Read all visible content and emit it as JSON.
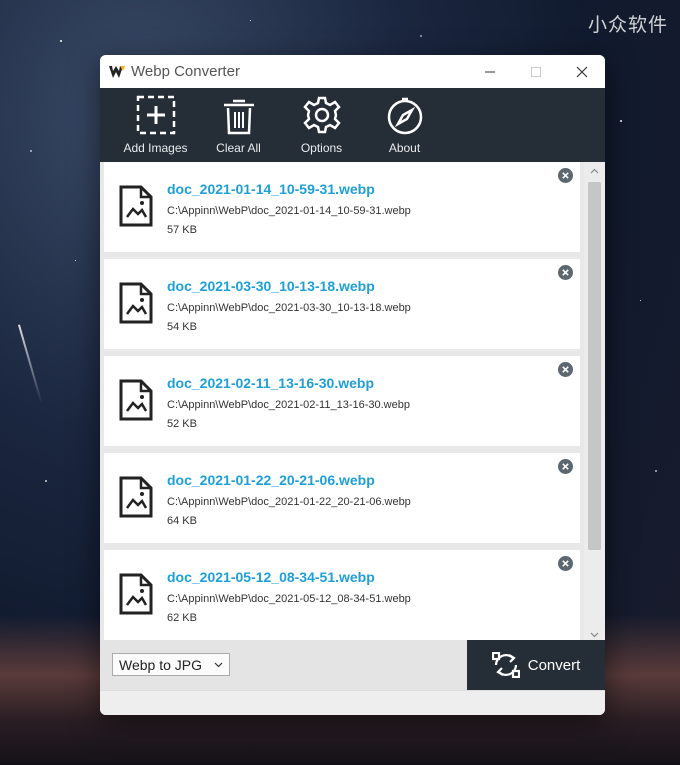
{
  "watermark": "小众软件",
  "window": {
    "title": "Webp Converter"
  },
  "toolbar": {
    "add_images": "Add Images",
    "clear_all": "Clear All",
    "options": "Options",
    "about": "About"
  },
  "files": [
    {
      "name": "doc_2021-01-14_10-59-31.webp",
      "path": "C:\\Appinn\\WebP\\doc_2021-01-14_10-59-31.webp",
      "size": "57 KB"
    },
    {
      "name": "doc_2021-03-30_10-13-18.webp",
      "path": "C:\\Appinn\\WebP\\doc_2021-03-30_10-13-18.webp",
      "size": "54 KB"
    },
    {
      "name": "doc_2021-02-11_13-16-30.webp",
      "path": "C:\\Appinn\\WebP\\doc_2021-02-11_13-16-30.webp",
      "size": "52 KB"
    },
    {
      "name": "doc_2021-01-22_20-21-06.webp",
      "path": "C:\\Appinn\\WebP\\doc_2021-01-22_20-21-06.webp",
      "size": "64 KB"
    },
    {
      "name": "doc_2021-05-12_08-34-51.webp",
      "path": "C:\\Appinn\\WebP\\doc_2021-05-12_08-34-51.webp",
      "size": "62 KB"
    }
  ],
  "bottom": {
    "format_selected": "Webp to JPG",
    "convert_label": "Convert"
  },
  "colors": {
    "toolbar_bg": "#252d36",
    "file_name": "#1f9fd8",
    "remove_icon": "#5d6770"
  },
  "icons": {
    "add_images": "add-box-icon",
    "clear_all": "trash-icon",
    "options": "gear-icon",
    "about": "compass-icon",
    "file": "image-file-icon",
    "remove": "remove-x-icon",
    "convert": "convert-arrows-icon"
  }
}
